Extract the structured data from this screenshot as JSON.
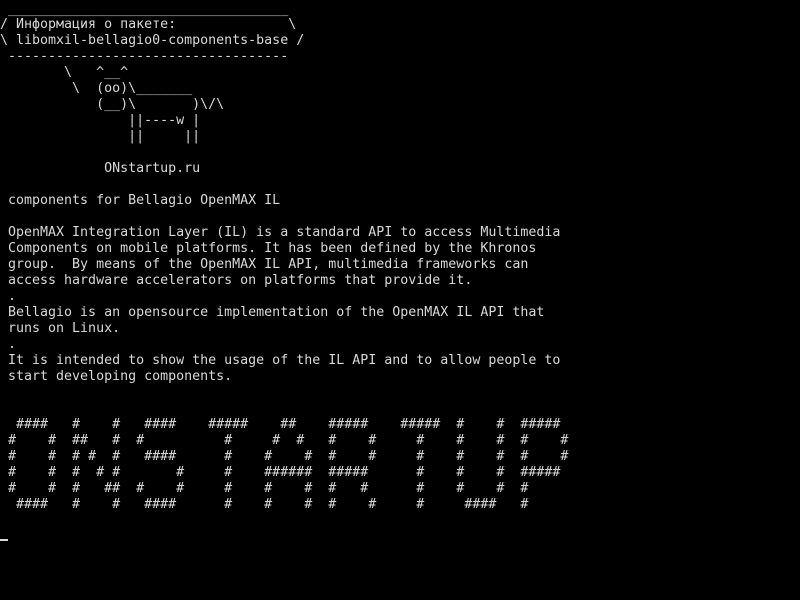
{
  "terminal": {
    "lines": [
      " ___________________________________",
      "/ Информация о пакете:              \\",
      "\\ libomxil-bellagio0-components-base /",
      " -----------------------------------",
      "        \\   ^__^",
      "         \\  (oo)\\_______",
      "            (__)\\       )\\/\\",
      "                ||----w |",
      "                ||     ||",
      "",
      "             ONstartup.ru",
      "",
      " components for Bellagio OpenMAX IL",
      "",
      " OpenMAX Integration Layer (IL) is a standard API to access Multimedia",
      " Components on mobile platforms. It has been defined by the Khronos",
      " group.  By means of the OpenMAX IL API, multimedia frameworks can",
      " access hardware accelerators on platforms that provide it.",
      " .",
      " Bellagio is an opensource implementation of the OpenMAX IL API that",
      " runs on Linux.",
      " .",
      " It is intended to show the usage of the IL API and to allow people to",
      " start developing components.",
      "",
      "",
      "  ####   #    #   ####    #####    ##    #####    #####  #    #  #####",
      " #    #  ##   #  #          #     #  #   #    #     #    #    #  #    #",
      " #    #  # #  #   ####      #    #    #  #    #     #    #    #  #    #",
      " #    #  #  # #       #     #    ######  #####      #    #    #  #####",
      " #    #  #   ##  #    #     #    #    #  #   #      #    #    #  #",
      "  ####   #    #   ####      #    #    #  #    #     #     ####   #"
    ],
    "cursor_symbol": "_"
  }
}
